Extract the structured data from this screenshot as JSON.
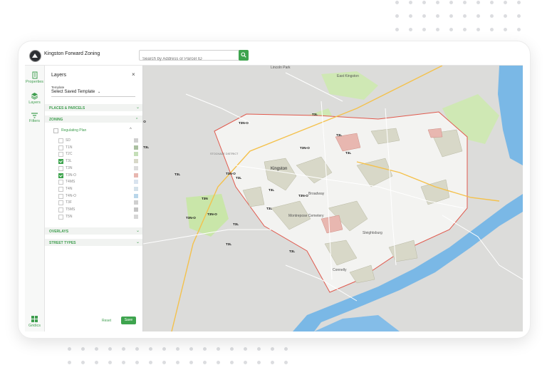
{
  "app": {
    "title": "Kingston Forward Zoning"
  },
  "search": {
    "placeholder": "Search by Address or Parcel ID"
  },
  "rail": {
    "items": [
      {
        "label": "Properties",
        "icon": "building-icon"
      },
      {
        "label": "Layers",
        "icon": "layers-icon"
      },
      {
        "label": "Filters",
        "icon": "filter-icon"
      },
      {
        "label": "Gridics",
        "icon": "grid-icon"
      }
    ]
  },
  "panel": {
    "title": "Layers",
    "close": "×",
    "template_label": "Template",
    "template_value": "Select Saved Template",
    "template_caret": "⌄",
    "sections": {
      "places": "PLACES & PARCELS",
      "zoning": "ZONING",
      "overlays": "OVERLAYS",
      "street_types": "STREET TYPES"
    },
    "caret_down": "⌄",
    "caret_up": "^",
    "regulating_plan": "Regulating Plan",
    "layers": [
      {
        "label": "SD",
        "checked": false,
        "color": "#cfcfcf"
      },
      {
        "label": "T1N",
        "checked": false,
        "color": "#a9bfa0"
      },
      {
        "label": "T2C",
        "checked": false,
        "color": "#c5dfb8"
      },
      {
        "label": "T3L",
        "checked": true,
        "color": "#d8d8c8"
      },
      {
        "label": "T3N",
        "checked": false,
        "color": "#dcdcdc"
      },
      {
        "label": "T3N-O",
        "checked": true,
        "color": "#e8b7b0"
      },
      {
        "label": "T4MS",
        "checked": false,
        "color": "#d9e3ee"
      },
      {
        "label": "T4N",
        "checked": false,
        "color": "#d4e1ea"
      },
      {
        "label": "T4N-O",
        "checked": false,
        "color": "#b9d6ea"
      },
      {
        "label": "T3F",
        "checked": false,
        "color": "#cfcfcf"
      },
      {
        "label": "T5MS",
        "checked": false,
        "color": "#c4c4c4"
      },
      {
        "label": "T5N",
        "checked": false,
        "color": "#d6d6d6"
      }
    ],
    "reset": "Reset",
    "save": "Save"
  },
  "map": {
    "place_labels": [
      {
        "text": "Kingston",
        "kind": "town"
      },
      {
        "text": "Lincoln Park",
        "kind": "place"
      },
      {
        "text": "East Kingston",
        "kind": "place"
      },
      {
        "text": "Hillside",
        "kind": "place"
      },
      {
        "text": "Connelly",
        "kind": "place"
      },
      {
        "text": "Sleightsburg",
        "kind": "place"
      },
      {
        "text": "Montrepose Cemetery",
        "kind": "place"
      },
      {
        "text": "Broadway",
        "kind": "street"
      },
      {
        "text": "STOCKADE DISTRICT",
        "kind": "district"
      }
    ],
    "zone_labels": [
      "T3N-O",
      "T3L",
      "T3N-O",
      "T3L",
      "T3N",
      "T3L",
      "T3N-O",
      "T3L",
      "T3N-O",
      "T3L",
      "T3N-O",
      "T3L",
      "T3L",
      "T3N-O",
      "T3L",
      "T3L",
      "T3N-O",
      "T3L",
      "T3L"
    ],
    "colors": {
      "accent": "#3ea44e",
      "water": "#7ab8e6",
      "park": "#c9e6a9",
      "city_boundary": "#e0594d"
    }
  }
}
